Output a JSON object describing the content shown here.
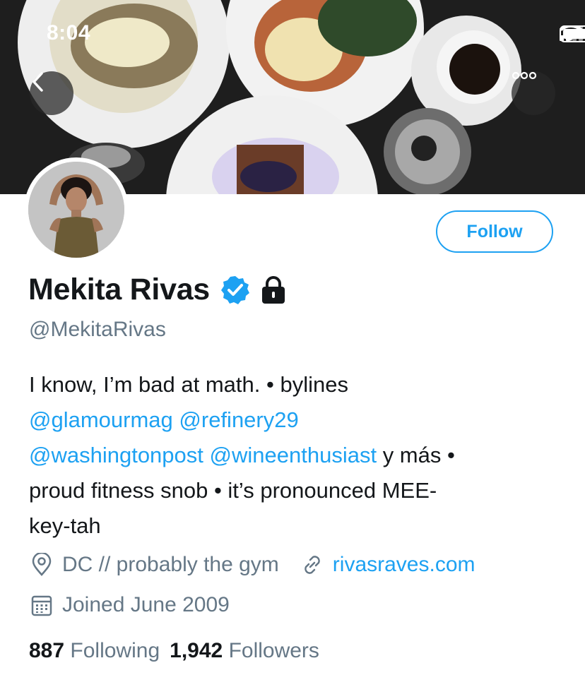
{
  "status_bar": {
    "time": "8:04"
  },
  "nav": {
    "back_icon": "chevron-left-icon",
    "more_icon": "ellipsis-icon"
  },
  "profile": {
    "name": "Mekita Rivas",
    "handle": "@MekitaRivas",
    "follow_label": "Follow",
    "bio": {
      "line1_text": "I know, I’m bad at math. • bylines",
      "mention1": "@glamourmag",
      "mention2": "@refinery29",
      "mention3": "@washingtonpost",
      "mention4": "@wineenthusiast",
      "after_mentions": " y más •",
      "line4_text": "proud fitness snob • it’s pronounced MEE-",
      "line5_text": "key-tah"
    },
    "location": "DC // probably the gym",
    "website": "rivasraves.com",
    "joined": "Joined June 2009",
    "following_count": "887",
    "following_label": "Following",
    "followers_count": "1,942",
    "followers_label": "Followers"
  },
  "colors": {
    "accent": "#1da1f2",
    "secondary_text": "#657786",
    "primary_text": "#14171a"
  }
}
